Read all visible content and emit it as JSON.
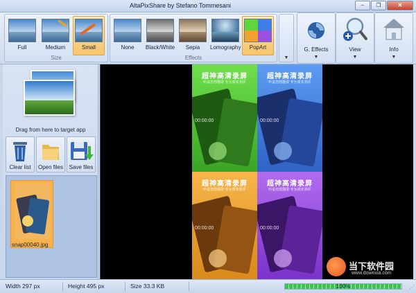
{
  "window": {
    "title": "AltaPixShare by Stefano Tommesani"
  },
  "ribbon": {
    "size_group": {
      "label": "Size",
      "buttons": [
        "Full",
        "Medium",
        "Small"
      ],
      "selected": "Small"
    },
    "effects_group": {
      "label": "Effects",
      "buttons": [
        "None",
        "Black/White",
        "Sepia",
        "Lomography",
        "PopArt"
      ],
      "selected": "PopArt"
    },
    "g_effects": "G. Effects",
    "view": "View",
    "info": "Info"
  },
  "left_panel": {
    "drag_label": "Drag from here to target app",
    "actions": [
      "Clear list",
      "Open files",
      "Save files"
    ],
    "file_name": "snap00040.jpg"
  },
  "canvas": {
    "title": "超神高清录屏",
    "subtitle": "听说您想翻录 专为真实测评",
    "clock": "00:00:00"
  },
  "status": {
    "width": "Width 297 px",
    "height": "Height 495 px",
    "size": "Size 33.3 KB",
    "progress_label": "100%",
    "progress": 1.0
  },
  "watermark": {
    "brand": "当下软件园",
    "url": "www.downxia.com"
  },
  "colors": {
    "accent_selected": "#f7c46a",
    "quad_green": "#5fd63c",
    "quad_blue": "#3f7ee8",
    "quad_orange": "#f2a12d",
    "quad_purple": "#9b4fe0"
  }
}
